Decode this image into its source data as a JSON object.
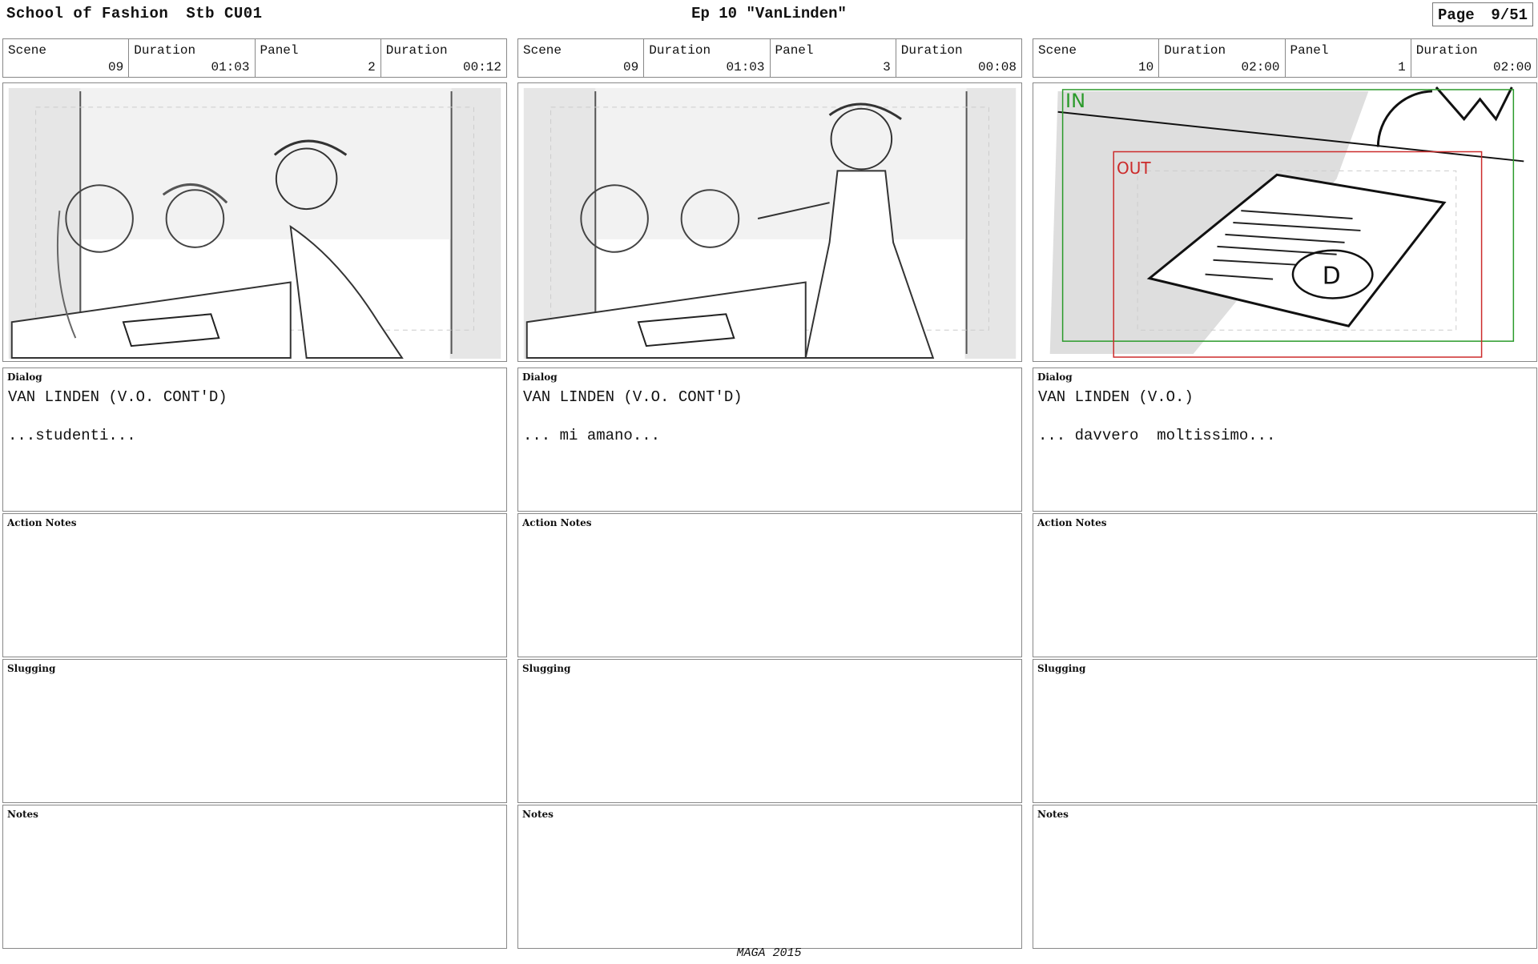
{
  "header": {
    "show": "School of Fashion",
    "stb": "Stb CU01",
    "episode": "Ep 10 \"VanLinden\"",
    "page_label": "Page",
    "page_number": "9/51"
  },
  "labels": {
    "scene": "Scene",
    "duration": "Duration",
    "panel": "Panel",
    "dialog": "Dialog",
    "action_notes": "Action Notes",
    "slugging": "Slugging",
    "notes": "Notes"
  },
  "columns": [
    {
      "scene": "09",
      "scene_duration": "01:03",
      "panel": "2",
      "panel_duration": "00:12",
      "dialog_speaker": "VAN LINDEN (V.O. CONT'D)",
      "dialog_line": "...studenti...",
      "frame_icon": "classroom-sketch"
    },
    {
      "scene": "09",
      "scene_duration": "01:03",
      "panel": "3",
      "panel_duration": "00:08",
      "dialog_speaker": "VAN LINDEN (V.O. CONT'D)",
      "dialog_line": "... mi amano...",
      "frame_icon": "teacher-sketch"
    },
    {
      "scene": "10",
      "scene_duration": "02:00",
      "panel": "1",
      "panel_duration": "02:00",
      "dialog_speaker": "VAN LINDEN (V.O.)",
      "dialog_line": "... davvero  moltissimo...",
      "frame_icon": "paper-grade-sketch",
      "camera_in_label": "IN",
      "camera_out_label": "OUT"
    }
  ],
  "footer": "MAGA 2015",
  "colors": {
    "in_frame": "#2a9a2a",
    "out_frame": "#cc2b2b",
    "frame_gray": "#e6e6e6"
  }
}
